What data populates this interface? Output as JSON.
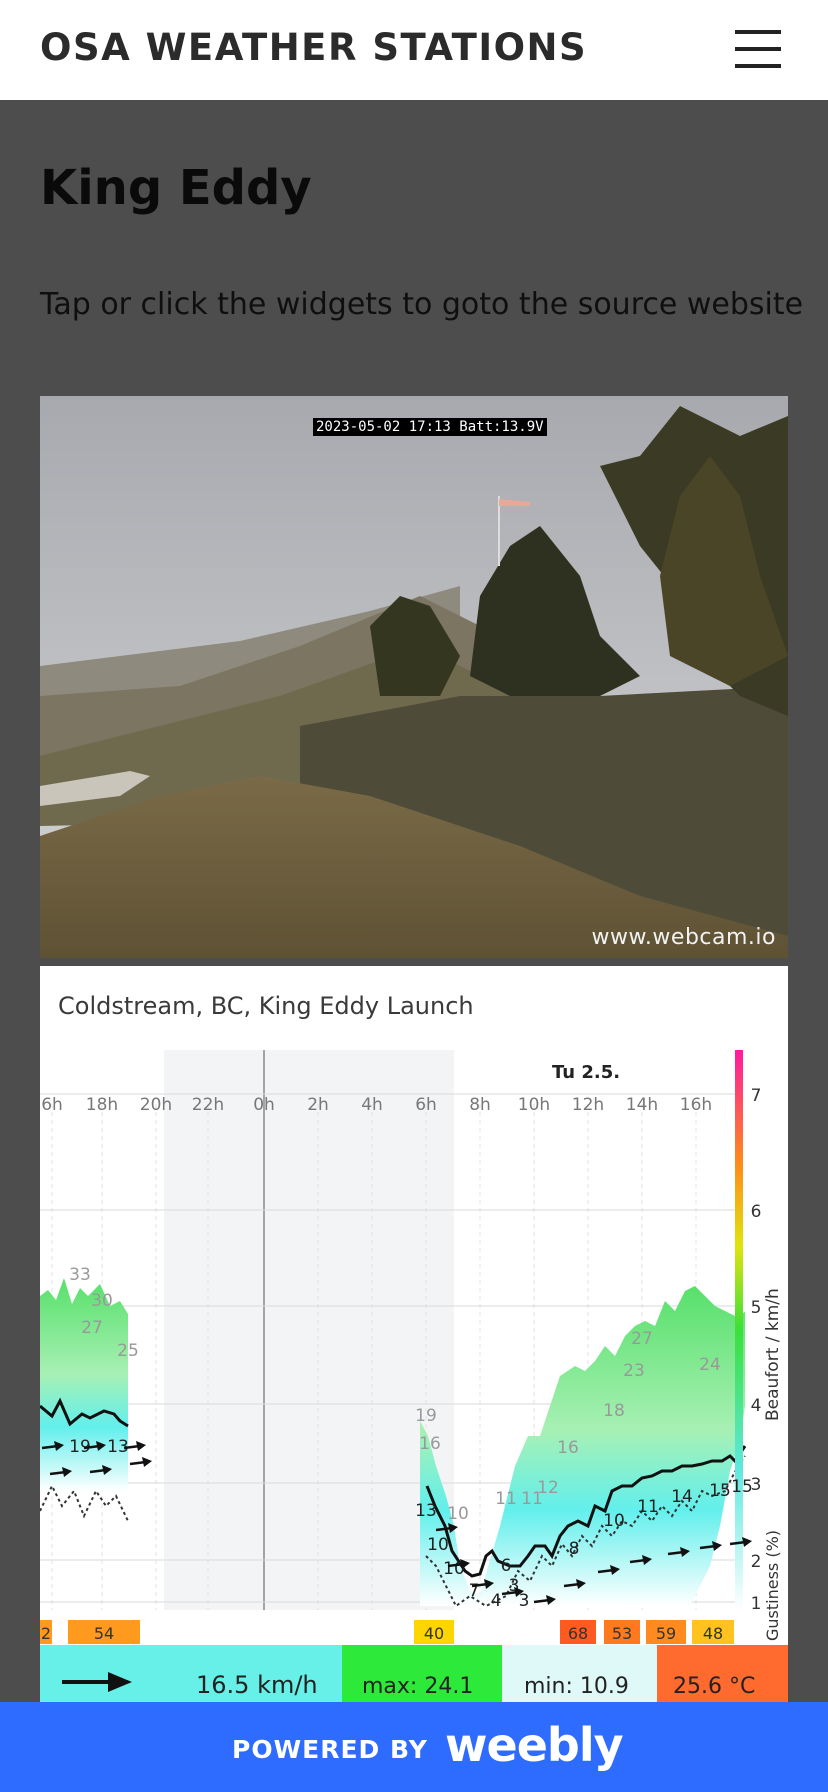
{
  "header": {
    "site_title": "OSA WEATHER STATIONS",
    "menu_icon": "hamburger-menu-icon"
  },
  "main": {
    "page_title": "King Eddy",
    "intro_text": "Tap or click the widgets to goto the source website"
  },
  "webcam": {
    "timestamp_overlay": "2023-05-02  17:13  Batt:13.9V",
    "credit": "www.webcam.io"
  },
  "windgraph": {
    "station_name": "Coldstream, BC, King Eddy Launch",
    "day_label": "Tu 2.5.",
    "current_wind": "16.5 km/h",
    "max_label": "max: 24.1",
    "min_label": "min: 10.9",
    "temperature": "25.6 °C",
    "right_axis_label": "Beaufort / km/h",
    "gustiness_label": "Gustiness (%)",
    "colors": {
      "current": "#66f0e8",
      "max": "#2dea3a",
      "min": "#dff8f8",
      "temp": "#ff6a2e"
    }
  },
  "chart_data": {
    "type": "area",
    "x_tick_labels": [
      "6h",
      "18h",
      "20h",
      "22h",
      "0h",
      "2h",
      "4h",
      "6h",
      "8h",
      "10h",
      "12h",
      "14h",
      "16h"
    ],
    "beaufort_scale_labels": [
      "7",
      "6",
      "5",
      "4",
      "3",
      "2",
      "1"
    ],
    "grid": true,
    "gust_value_labels": [
      "33",
      "30",
      "27",
      "25",
      "19",
      "16",
      "10",
      "11",
      "11",
      "12",
      "16",
      "18",
      "23",
      "27",
      "24"
    ],
    "avg_value_labels": [
      "19",
      "13",
      "13",
      "10",
      "10",
      "7",
      "4",
      "3",
      "3",
      "6",
      "8",
      "10",
      "11",
      "14",
      "15",
      "15"
    ],
    "gustiness_boxes": [
      {
        "label": "2",
        "color": "#ff9a1f"
      },
      {
        "label": "54",
        "color": "#ff9a1f"
      },
      {
        "label": "40",
        "color": "#ffd500"
      },
      {
        "label": "68",
        "color": "#ff5a1f"
      },
      {
        "label": "53",
        "color": "#ff7a1f"
      },
      {
        "label": "59",
        "color": "#ff8a1f"
      },
      {
        "label": "48",
        "color": "#ffc21f"
      }
    ]
  },
  "footer": {
    "powered_by": "POWERED BY",
    "brand": "weebly"
  }
}
